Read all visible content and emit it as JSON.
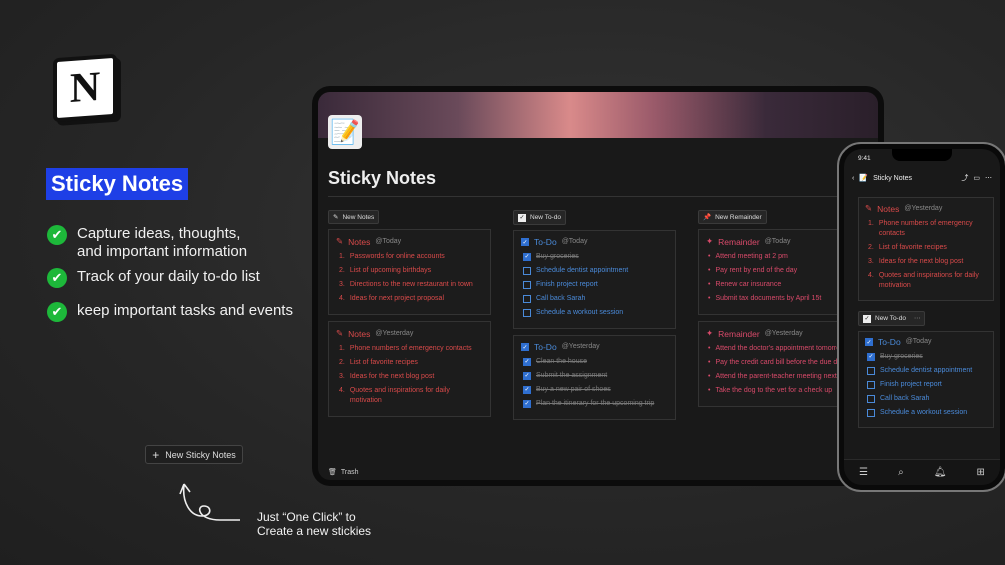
{
  "hero": {
    "title": "Sticky Notes",
    "features": [
      "Capture ideas, thoughts, and important information",
      "Track of your daily to-do list",
      "keep important tasks and events"
    ],
    "new_button": "New Sticky Notes",
    "caption_line1": "Just “One Click” to",
    "caption_line2": "Create a new stickies"
  },
  "logo": {
    "letter": "N"
  },
  "tablet": {
    "page_title": "Sticky Notes",
    "columns": [
      {
        "chip": "New Notes"
      },
      {
        "chip": "New To-do"
      },
      {
        "chip": "New Remainder"
      }
    ],
    "notes": [
      {
        "title": "Notes",
        "date": "@Today",
        "items": [
          "Passwords for online accounts",
          "List of upcoming birthdays",
          "Directions to the new restaurant in town",
          "Ideas for next project proposal"
        ]
      },
      {
        "title": "Notes",
        "date": "@Yesterday",
        "items": [
          "Phone numbers of emergency contacts",
          "List of favorite recipes",
          "Ideas for the next blog post",
          "Quotes and inspirations for daily motivation"
        ]
      }
    ],
    "todos": [
      {
        "title": "To-Do",
        "date": "@Today",
        "items": [
          {
            "text": "Buy groceries",
            "done": true
          },
          {
            "text": "Schedule dentist appointment",
            "done": false
          },
          {
            "text": "Finish project report",
            "done": false
          },
          {
            "text": "Call back Sarah",
            "done": false
          },
          {
            "text": "Schedule a workout session",
            "done": false
          }
        ]
      },
      {
        "title": "To-Do",
        "date": "@Yesterday",
        "items": [
          {
            "text": "Clean the house",
            "done": true
          },
          {
            "text": "Submit the assignment",
            "done": true
          },
          {
            "text": "Buy a new pair of shoes",
            "done": true
          },
          {
            "text": "Plan the itinerary for the upcoming trip",
            "done": true
          }
        ]
      }
    ],
    "reminders": [
      {
        "title": "Remainder",
        "date": "@Today",
        "items": [
          "Attend meeting at 2 pm",
          "Pay rent by end of the day",
          "Renew car insurance",
          "Submit tax documents by April 15t"
        ]
      },
      {
        "title": "Remainder",
        "date": "@Yesterday",
        "items": [
          "Attend the doctor's appointment tomorrow",
          "Pay the credit card bill before the due date",
          "Attend the parent-teacher meeting next week",
          "Take the dog to the vet for a check up"
        ]
      }
    ],
    "trash": "Trash"
  },
  "phone": {
    "time": "9:41",
    "nav_title": "Sticky Notes",
    "notes": {
      "title": "Notes",
      "date": "@Yesterday",
      "items": [
        "Phone numbers of emergency contacts",
        "List of favorite recipes",
        "Ideas for the next blog post",
        "Quotes and inspirations for daily motivation"
      ]
    },
    "todo_chip": "New To-do",
    "todo": {
      "title": "To-Do",
      "date": "@Today",
      "items": [
        {
          "text": "Buy groceries",
          "done": true
        },
        {
          "text": "Schedule dentist appointment",
          "done": false
        },
        {
          "text": "Finish project report",
          "done": false
        },
        {
          "text": "Call back Sarah",
          "done": false
        },
        {
          "text": "Schedule a workout session",
          "done": false
        }
      ]
    }
  },
  "colors": {
    "accent_blue": "#1e3fe6",
    "check_green": "#1db83a",
    "note_red": "#d94a4a",
    "todo_blue": "#4a8ad9",
    "reminder_pink": "#d94a6a"
  }
}
